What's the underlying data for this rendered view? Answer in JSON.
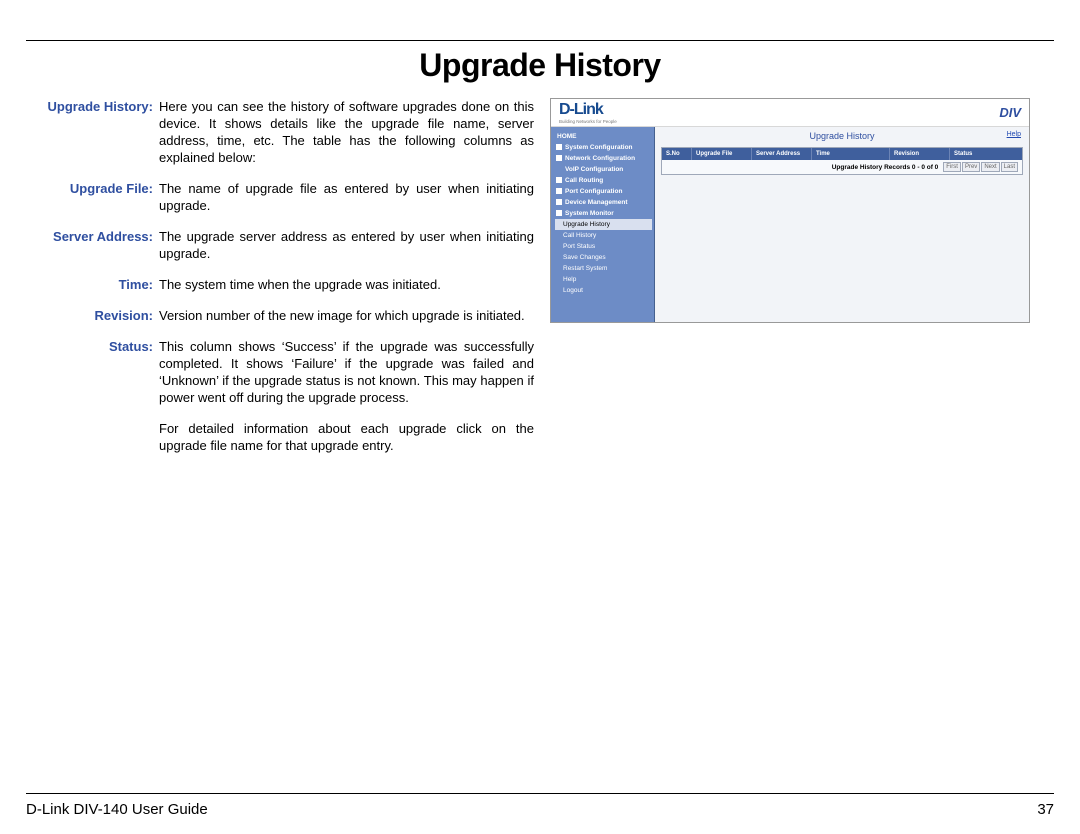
{
  "title": "Upgrade History",
  "definitions": [
    {
      "label": "Upgrade History:",
      "text": "Here you can see the history of software upgrades done on this device. It shows details like the upgrade file name, server address, time, etc. The table has the following columns as explained below:"
    },
    {
      "label": "Upgrade File:",
      "text": "The name of upgrade file as entered by user when initiating upgrade."
    },
    {
      "label": "Server Address:",
      "text": "The upgrade server address as entered by user when initiating upgrade."
    },
    {
      "label": "Time:",
      "text": "The system time when the upgrade was initiated."
    },
    {
      "label": "Revision:",
      "text": "Version number of the new image for which upgrade is initiated."
    },
    {
      "label": "Status:",
      "text": "This column shows ‘Success’ if the upgrade was successfully completed. It shows ‘Failure’ if the upgrade was failed and ‘Unknown’ if the upgrade status is not known. This may happen if power went off during the upgrade process.",
      "text2": "For detailed information about each upgrade click on the upgrade file name for that upgrade entry."
    }
  ],
  "screenshot": {
    "brand_name": "D-Link",
    "brand_tag": "Building Networks for People",
    "brand_product": "DIV",
    "nav": {
      "home": "HOME",
      "sections": [
        {
          "label": "System Configuration"
        },
        {
          "label": "Network Configuration"
        },
        {
          "label": "VoIP Configuration",
          "plain": true
        },
        {
          "label": "Call Routing"
        },
        {
          "label": "Port Configuration"
        },
        {
          "label": "Device Management"
        },
        {
          "label": "System Monitor"
        }
      ],
      "sub_items": [
        {
          "label": "Upgrade History",
          "selected": true
        },
        {
          "label": "Call History"
        },
        {
          "label": "Port Status"
        }
      ],
      "tail": [
        "Save Changes",
        "Restart System",
        "Help",
        "Logout"
      ]
    },
    "main": {
      "title": "Upgrade History",
      "help": "Help",
      "columns": [
        "S.No",
        "Upgrade File",
        "Server Address",
        "Time",
        "Revision",
        "Status"
      ],
      "pager_text": "Upgrade History Records  0 - 0 of 0",
      "pager_buttons": [
        "First",
        "Prev",
        "Next",
        "Last"
      ]
    }
  },
  "footer": {
    "guide": "D-Link DIV-140 User Guide",
    "page": "37"
  }
}
